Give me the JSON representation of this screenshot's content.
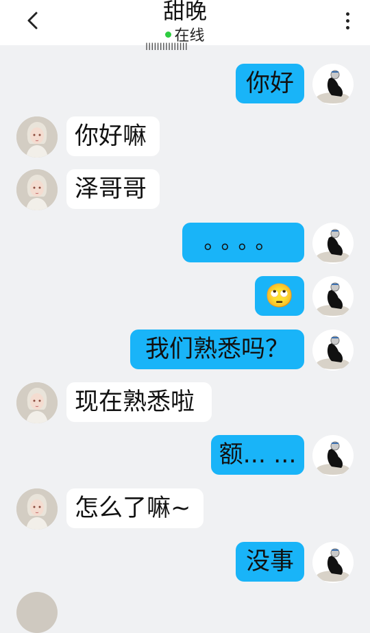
{
  "header": {
    "title": "甜晚",
    "status": "在线"
  },
  "faded_text": "IIIIIIIIIIIIIII",
  "messages": [
    {
      "side": "sent",
      "text": "你好"
    },
    {
      "side": "received",
      "text": "你好嘛"
    },
    {
      "side": "received",
      "text": "泽哥哥"
    },
    {
      "side": "sent",
      "text": "。。。。"
    },
    {
      "side": "sent",
      "text": "🙄"
    },
    {
      "side": "sent",
      "text": "我们熟悉吗？"
    },
    {
      "side": "received",
      "text": "现在熟悉啦"
    },
    {
      "side": "sent",
      "text": "额... ..."
    },
    {
      "side": "received",
      "text": "怎么了嘛~"
    },
    {
      "side": "sent",
      "text": "没事"
    }
  ],
  "colors": {
    "sent_bubble": "#19b4f8",
    "received_bubble": "#ffffff",
    "background": "#f0f1f3",
    "online_dot": "#2ecc40"
  },
  "icons": {
    "back": "chevron-left-icon",
    "more": "more-vertical-icon"
  }
}
